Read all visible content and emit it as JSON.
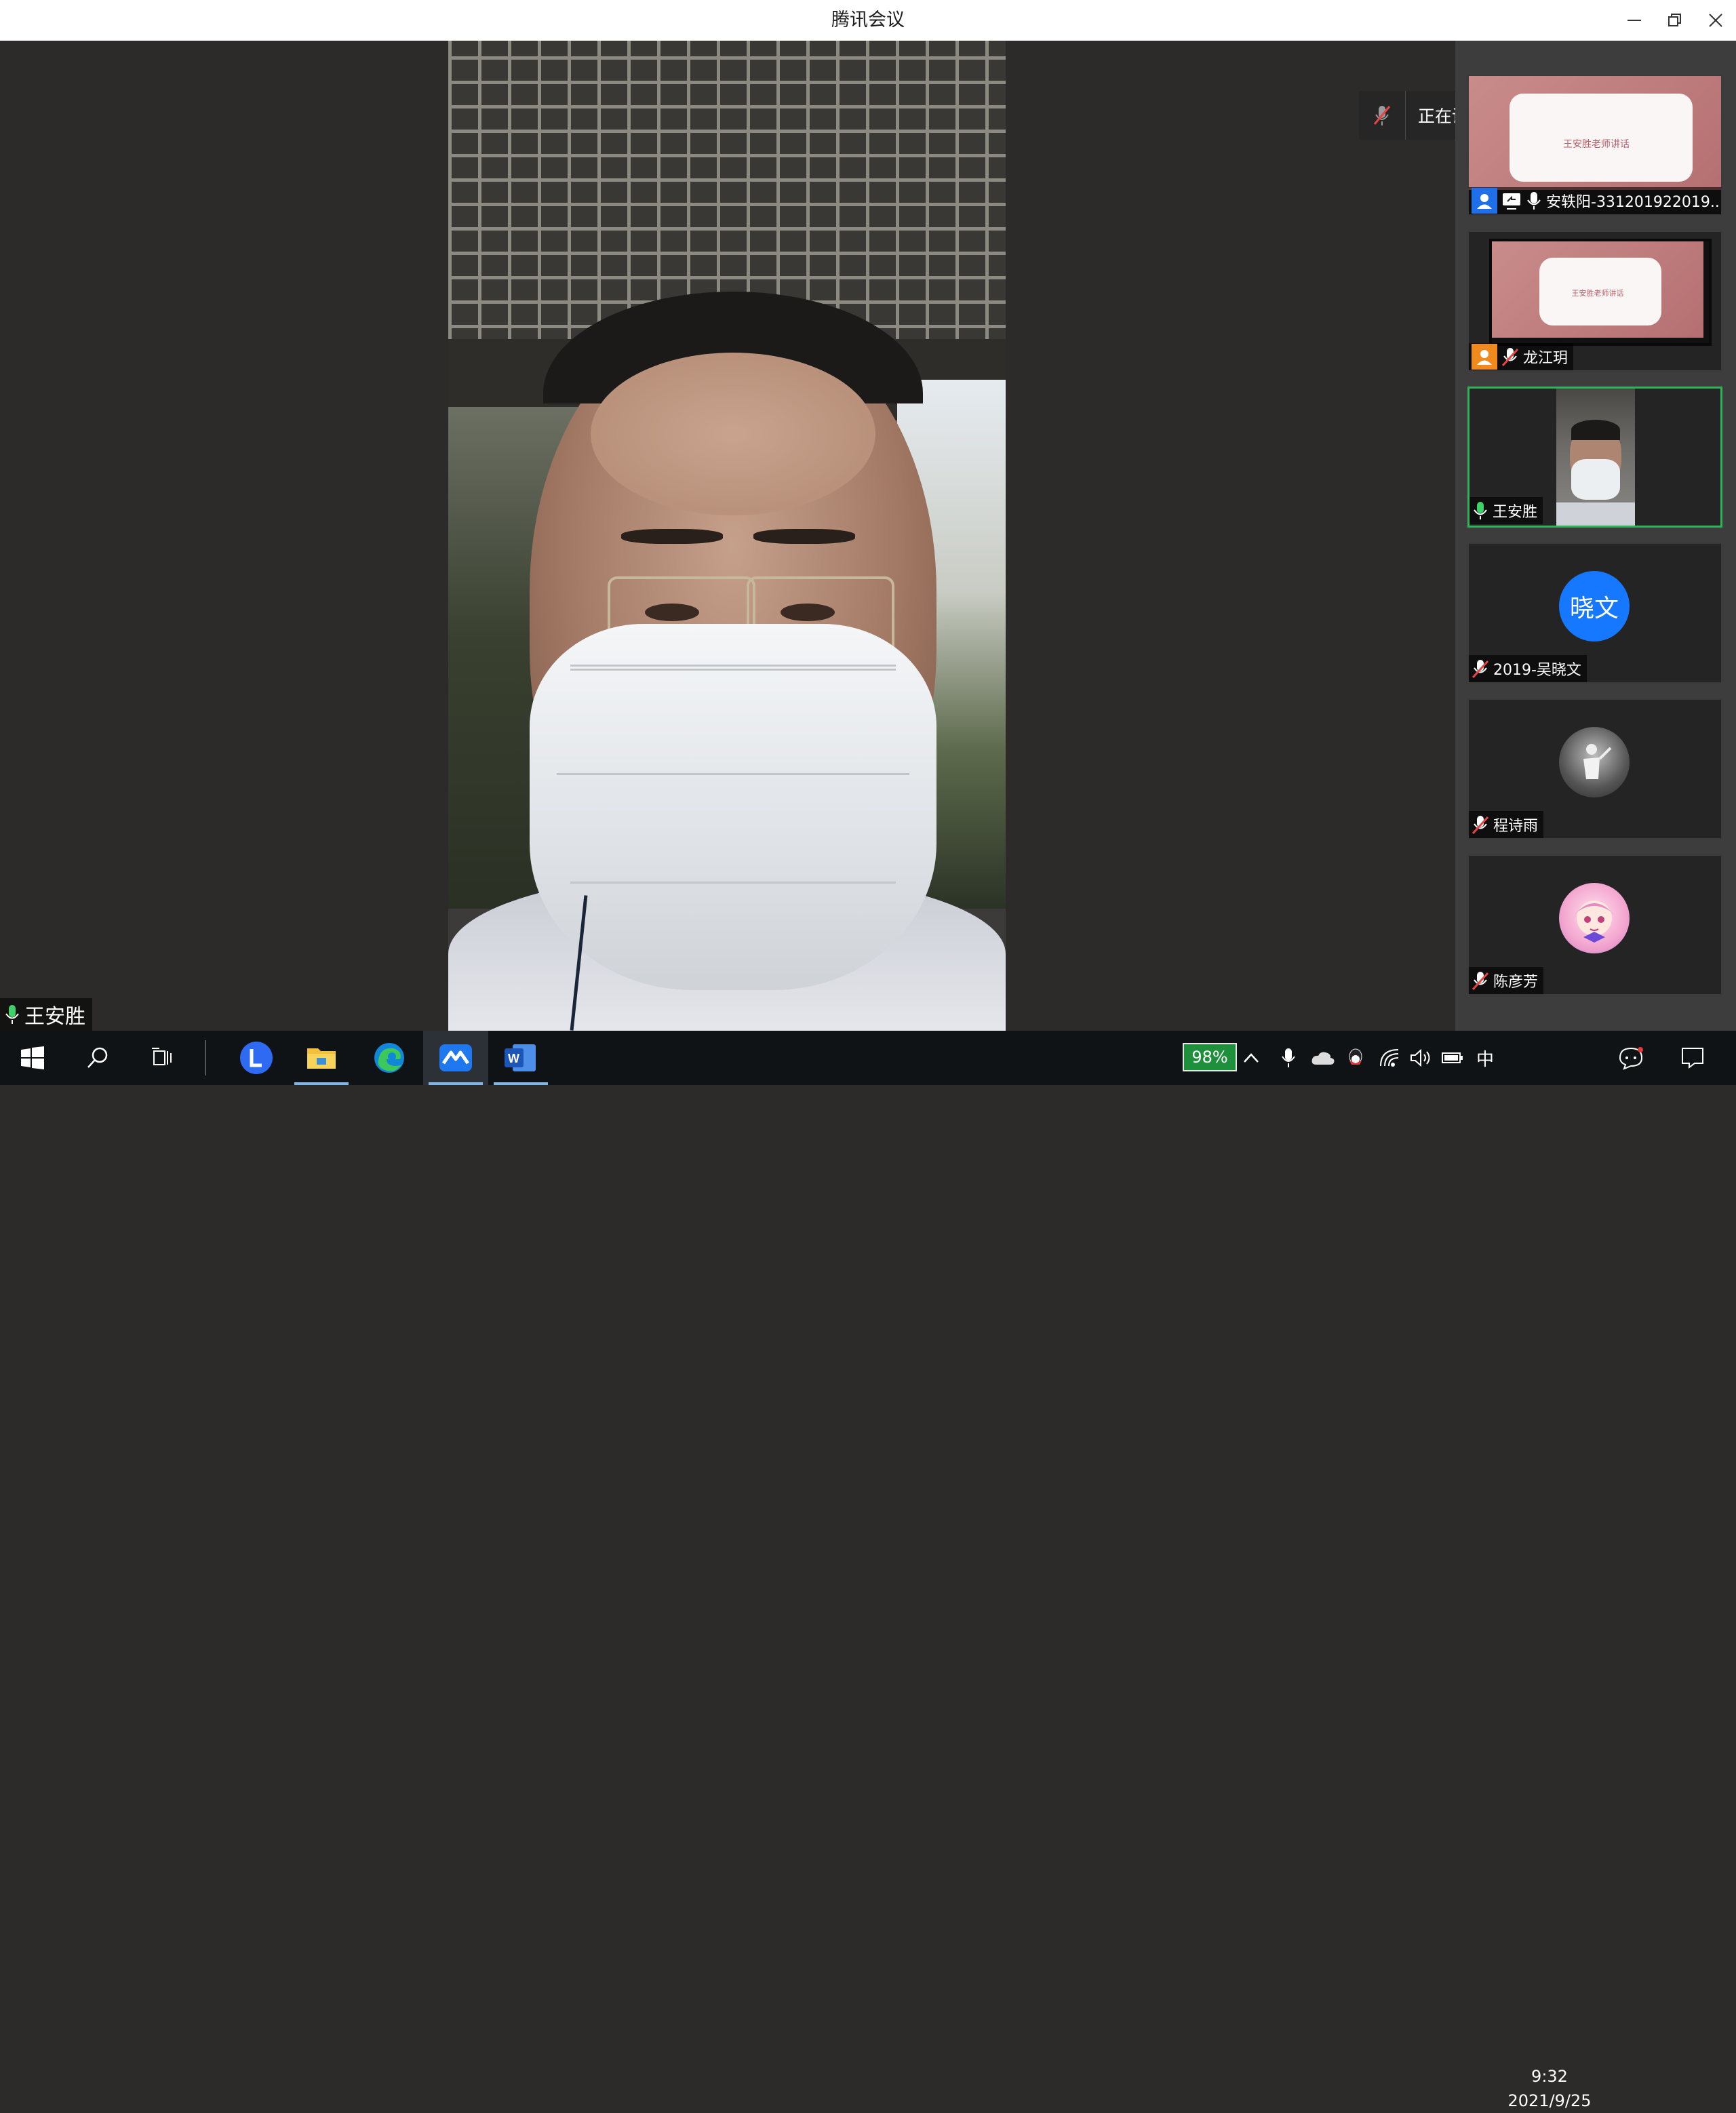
{
  "window": {
    "title": "腾讯会议",
    "controls": [
      "minimize",
      "restore",
      "close"
    ]
  },
  "main_video": {
    "speaker_name": "王安胜",
    "icon": "mic-icon"
  },
  "speaking_banner": {
    "text": "正在讲话: 王安胜;",
    "icon": "mic-muted-icon"
  },
  "participants": [
    {
      "name": "安轶阳-331201922019...",
      "icons": [
        "host-icon",
        "screen-share-icon",
        "mic-icon"
      ],
      "content": "shared-slide",
      "slide_caption": "王安胜老师讲话"
    },
    {
      "name": "龙江玥",
      "icons": [
        "cohost-icon",
        "mic-muted-icon"
      ],
      "content": "monitor-slide",
      "slide_caption": "王安胜老师讲话"
    },
    {
      "name": "王安胜",
      "icons": [
        "mic-icon"
      ],
      "content": "camera",
      "active": true
    },
    {
      "name": "2019-吴晓文",
      "icons": [
        "mic-muted-icon"
      ],
      "content": "avatar-text",
      "avatar_text": "晓文",
      "avatar_color": "#1677ff"
    },
    {
      "name": "程诗雨",
      "icons": [
        "mic-muted-icon"
      ],
      "content": "avatar-photo"
    },
    {
      "name": "陈彦芳",
      "icons": [
        "mic-muted-icon"
      ],
      "content": "avatar-anime"
    }
  ],
  "taskbar": {
    "apps": [
      "windows-start-icon",
      "search-icon",
      "task-view-icon",
      "lark-icon",
      "file-explorer-icon",
      "edge-icon",
      "tencent-meeting-icon",
      "word-icon"
    ],
    "battery_percent": "98%",
    "ime": "中",
    "time": "9:32",
    "date": "2021/9/25"
  },
  "colors": {
    "active_border": "#31b35a",
    "host_badge": "#1e6fe8",
    "cohost_badge": "#f08a1c",
    "muted_red": "#e64545",
    "battery_green": "#1e8f3a"
  }
}
